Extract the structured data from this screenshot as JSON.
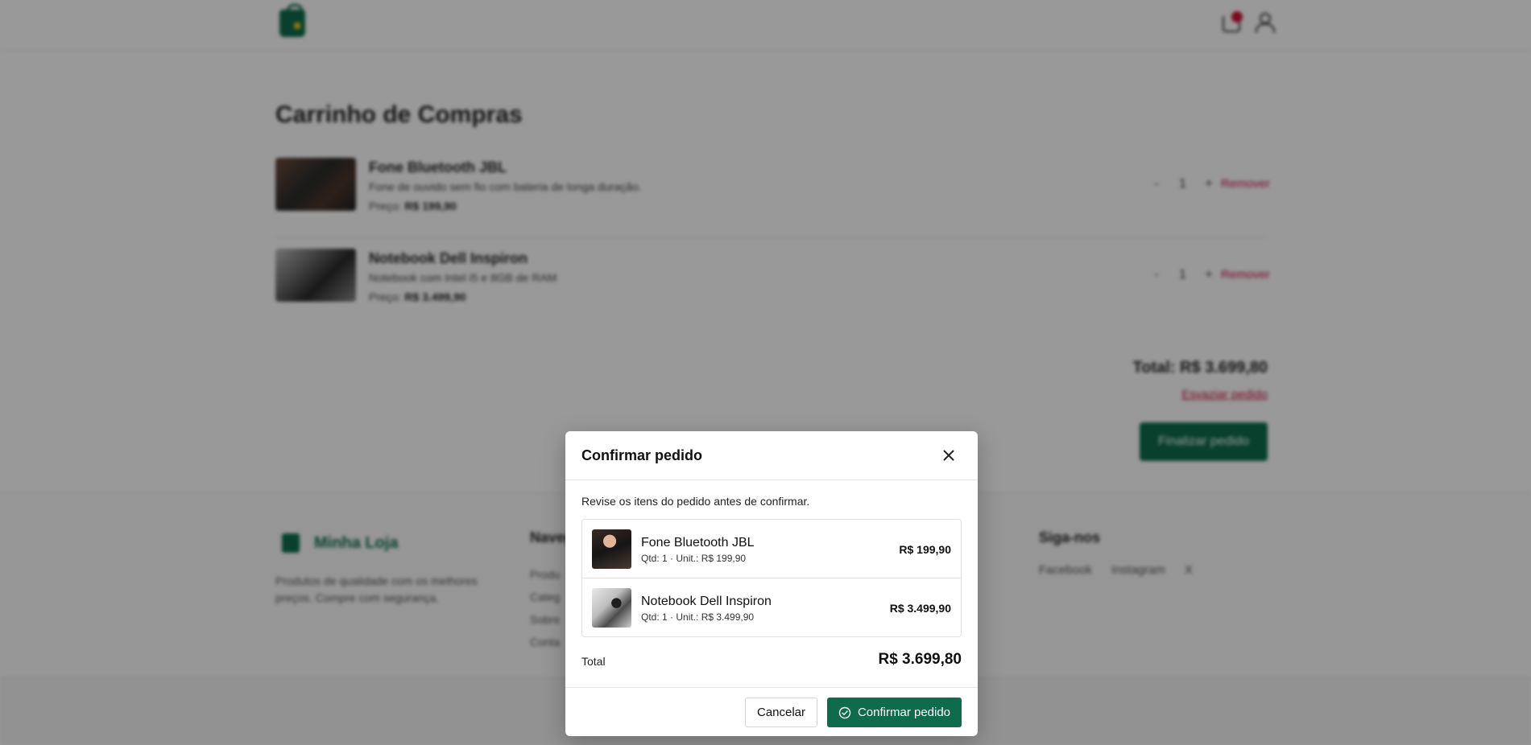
{
  "header": {
    "logo": "shopping-bag-icon",
    "cart_icon": "cart-icon",
    "user_icon": "user-icon"
  },
  "cart": {
    "title": "Carrinho de Compras",
    "items": [
      {
        "name": "Fone Bluetooth JBL",
        "description": "Fone de ouvido sem fio com bateria de longa duração.",
        "price_label": "Preço:",
        "price": "R$ 199,90",
        "quantity": "1",
        "decrement": "-",
        "increment": "+",
        "remove_label": "Remover"
      },
      {
        "name": "Notebook Dell Inspiron",
        "description": "Notebook com Intel i5 e 8GB de RAM",
        "price_label": "Preço:",
        "price": "R$ 3.499,90",
        "quantity": "1",
        "decrement": "-",
        "increment": "+",
        "remove_label": "Remover"
      }
    ],
    "total": "Total: R$ 3.699,80",
    "empty_label": "Esvaziar pedido",
    "finish_label": "Finalizar pedido"
  },
  "footer": {
    "brand": "Minha Loja",
    "tagline": "Produtos de qualidade com os melhores preços. Compre com segurança.",
    "nav_heading": "Naveg",
    "nav_links": [
      "Produ",
      "Categ",
      "Sobre",
      "Conta"
    ],
    "social_heading": "Siga-nos",
    "social_links": [
      "Facebook",
      "Instagram",
      "X"
    ]
  },
  "modal": {
    "title": "Confirmar pedido",
    "subtitle": "Revise os itens do pedido antes de confirmar.",
    "items": [
      {
        "name": "Fone Bluetooth JBL",
        "meta": "Qtd: 1 · Unit.: R$ 199,90",
        "subtotal": "R$ 199,90"
      },
      {
        "name": "Notebook Dell Inspiron",
        "meta": "Qtd: 1 · Unit.: R$ 3.499,90",
        "subtotal": "R$ 3.499,90"
      }
    ],
    "total_label": "Total",
    "total_value": "R$ 3.699,80",
    "cancel_label": "Cancelar",
    "confirm_label": "Confirmar pedido"
  },
  "colors": {
    "brand": "#0e6b4c",
    "danger": "#d0103a",
    "overlay": "rgba(0,0,0,0.4)"
  }
}
